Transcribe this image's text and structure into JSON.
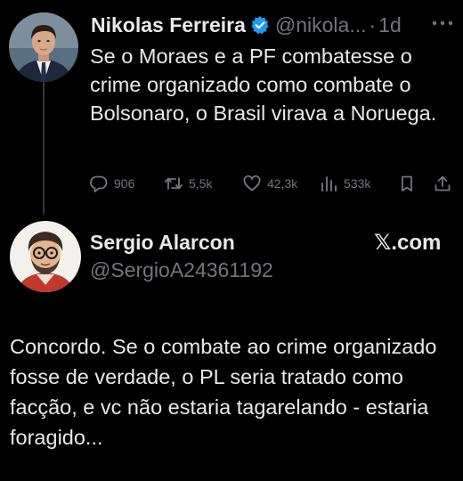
{
  "colors": {
    "background": "#000000",
    "text_primary": "#e7e9ea",
    "text_secondary": "#71767b",
    "verified_badge": "#1d9bf0",
    "thread_line": "#333639"
  },
  "parent_tweet": {
    "author_name": "Nikolas Ferreira",
    "handle": "@nikola...",
    "separator": "·",
    "time_ago": "1d",
    "verified": true,
    "text": "Se o Moraes e a PF combatesse o crime organizado como combate o Bolsonaro, o Brasil virava a Noruega.",
    "actions": {
      "replies": "906",
      "reposts": "5,5k",
      "likes": "42,3k",
      "views": "533k"
    },
    "icons": [
      "verified-icon",
      "more-icon",
      "reply-icon",
      "repost-icon",
      "like-icon",
      "views-icon",
      "bookmark-icon",
      "share-icon"
    ]
  },
  "reply": {
    "author_name": "Sergio Alarcon",
    "handle": "@SergioA24361192",
    "brand": "𝕏.com",
    "text": "Concordo. Se o combate ao crime organizado fosse de verdade, o PL seria tratado como facção, e vc não estaria tagarelando - estaria foragido..."
  }
}
